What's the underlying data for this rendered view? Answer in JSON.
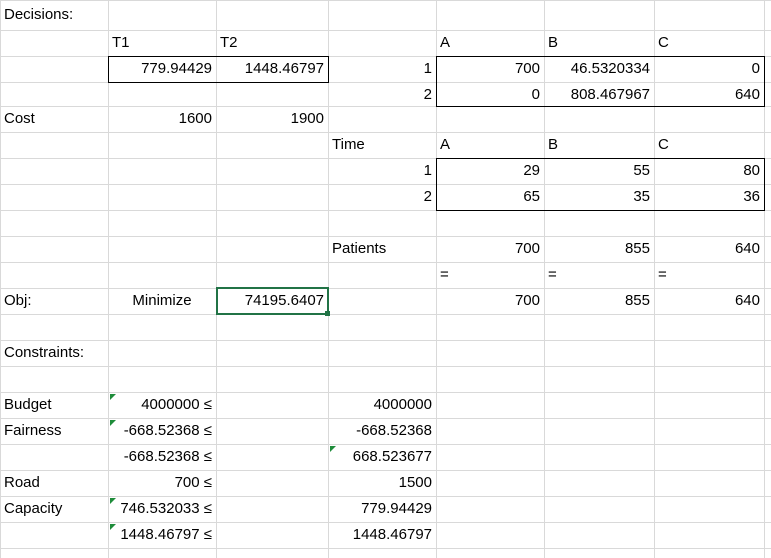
{
  "labels": {
    "decisions": "Decisions:",
    "cost": "Cost",
    "time": "Time",
    "patients": "Patients",
    "obj": "Obj:",
    "minimize": "Minimize",
    "constraints": "Constraints:"
  },
  "decisions": {
    "headers": [
      "T1",
      "T2"
    ],
    "values": [
      "779.94429",
      "1448.46797"
    ]
  },
  "cost": [
    "1600",
    "1900"
  ],
  "allocation": {
    "headers": [
      "A",
      "B",
      "C"
    ],
    "rows": [
      {
        "id": "1",
        "values": [
          "700",
          "46.5320334",
          "0"
        ]
      },
      {
        "id": "2",
        "values": [
          "0",
          "808.467967",
          "640"
        ]
      }
    ]
  },
  "time": {
    "headers": [
      "A",
      "B",
      "C"
    ],
    "rows": [
      {
        "id": "1",
        "values": [
          "29",
          "55",
          "80"
        ]
      },
      {
        "id": "2",
        "values": [
          "65",
          "35",
          "36"
        ]
      }
    ]
  },
  "patients": {
    "computed": [
      "700",
      "855",
      "640"
    ],
    "equals": [
      "=",
      "=",
      "="
    ],
    "required": [
      "700",
      "855",
      "640"
    ]
  },
  "objective": "74195.6407",
  "constraints": [
    {
      "label": "Budget",
      "lhs": "4000000",
      "op": "≤",
      "rhs": "4000000"
    },
    {
      "label": "Fairness",
      "lhs": "-668.52368",
      "op": "≤",
      "rhs": "-668.52368"
    },
    {
      "label": "",
      "lhs": "-668.52368",
      "op": "≤",
      "rhs": "668.523677"
    },
    {
      "label": "Road",
      "lhs": "700",
      "op": "≤",
      "rhs": "1500"
    },
    {
      "label": "Capacity",
      "lhs": "746.532033",
      "op": "≤",
      "rhs": "779.94429"
    },
    {
      "label": "",
      "lhs": "1448.46797",
      "op": "≤",
      "rhs": "1448.46797"
    }
  ],
  "colors": {
    "gridline": "#d9d9d9",
    "selection": "#217346",
    "formula_marker": "#1e8c3a"
  }
}
